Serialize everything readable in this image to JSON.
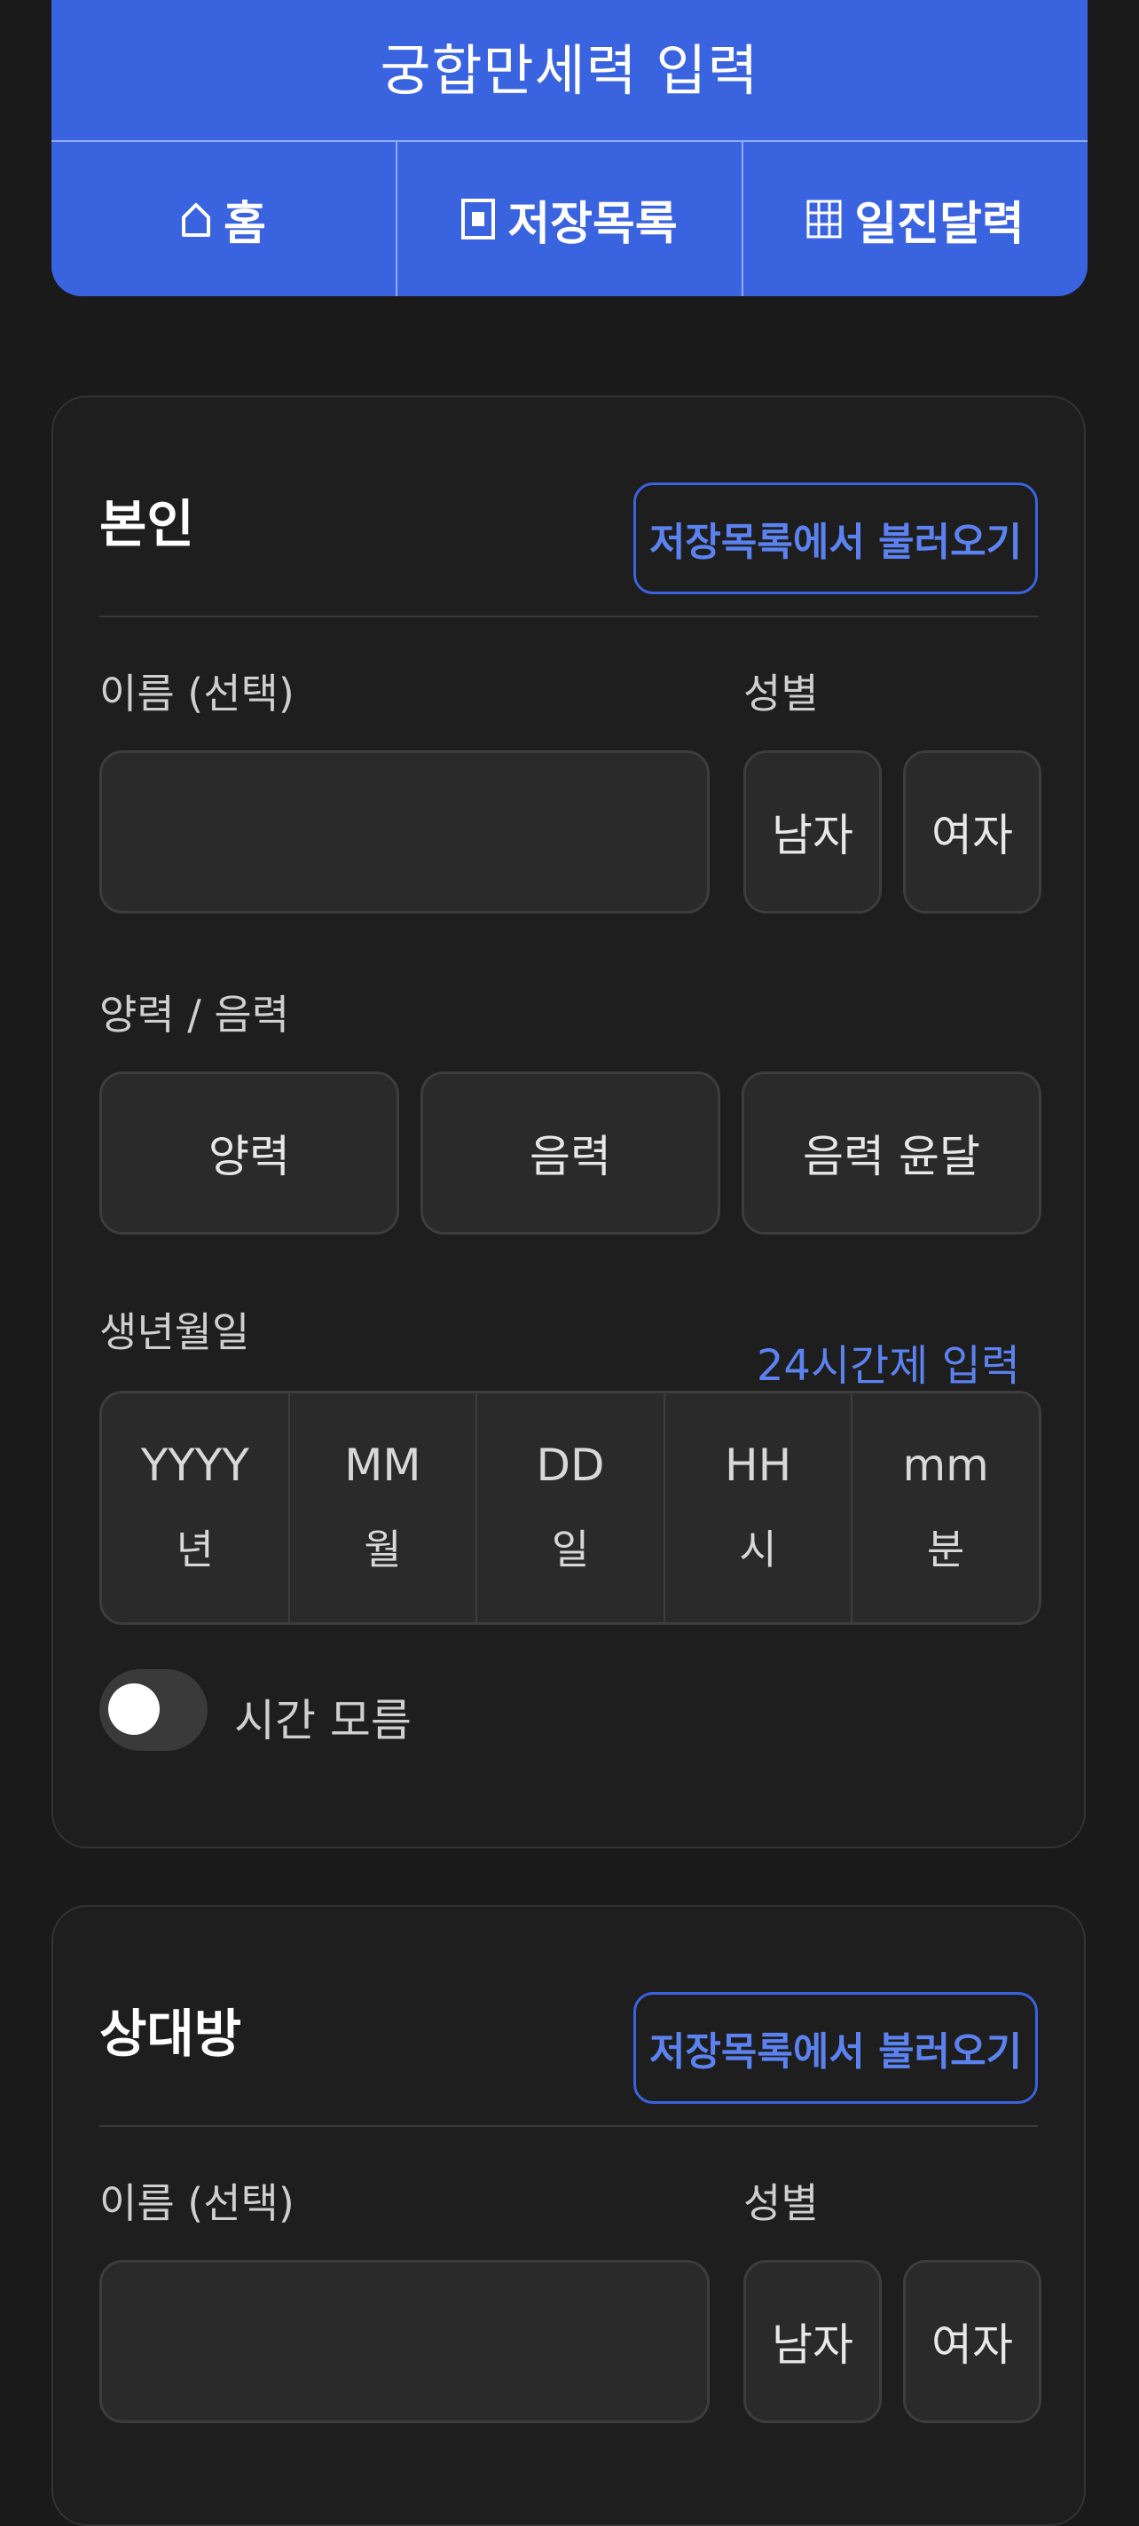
{
  "header": {
    "title": "궁합만세력 입력",
    "nav": [
      {
        "label": "홈",
        "icon": "home-icon"
      },
      {
        "label": "저장목록",
        "icon": "save-list-icon"
      },
      {
        "label": "일진달력",
        "icon": "calendar-grid-icon"
      }
    ]
  },
  "self_card": {
    "title": "본인",
    "load_label": "저장목록에서 불러오기",
    "name_label": "이름 (선택)",
    "name_value": "",
    "gender_label": "성별",
    "gender_options": [
      "남자",
      "여자"
    ],
    "calendar_label": "양력 / 음력",
    "calendar_options": [
      "양력",
      "음력",
      "음력 윤달"
    ],
    "birth_label": "생년월일",
    "hour24_label": "24시간제 입력",
    "date_fields": [
      {
        "placeholder": "YYYY",
        "unit": "년"
      },
      {
        "placeholder": "MM",
        "unit": "월"
      },
      {
        "placeholder": "DD",
        "unit": "일"
      },
      {
        "placeholder": "HH",
        "unit": "시"
      },
      {
        "placeholder": "mm",
        "unit": "분"
      }
    ],
    "unknown_time_label": "시간 모름",
    "unknown_time_on": false
  },
  "partner_card": {
    "title": "상대방",
    "load_label": "저장목록에서 불러오기",
    "name_label": "이름 (선택)",
    "name_value": "",
    "gender_label": "성별",
    "gender_options": [
      "남자",
      "여자"
    ]
  },
  "colors": {
    "accent": "#3a63e0",
    "accent_text": "#5b82f0",
    "background": "#1a1a1a",
    "card": "#1e1e1e"
  }
}
